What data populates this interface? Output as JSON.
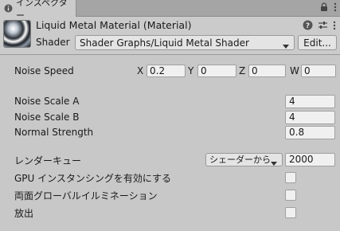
{
  "tab": {
    "label": "インスペクター",
    "icon": "info-icon"
  },
  "tabbar_icons": [
    "lock-icon",
    "menu-icon"
  ],
  "material": {
    "title": "Liquid Metal Material (Material)",
    "shader_label": "Shader",
    "shader_value": "Shader Graphs/Liquid Metal Shader",
    "edit_label": "Edit...",
    "header_icons": [
      "help-icon",
      "settings-sliders-icon",
      "kebab-menu-icon"
    ]
  },
  "properties": {
    "noise_speed": {
      "label": "Noise Speed",
      "x_label": "X",
      "x_value": "0.2",
      "y_label": "Y",
      "y_value": "0",
      "z_label": "Z",
      "z_value": "0",
      "w_label": "W",
      "w_value": "0"
    },
    "noise_scale_a": {
      "label": "Noise Scale A",
      "value": "4"
    },
    "noise_scale_b": {
      "label": "Noise Scale B",
      "value": "4"
    },
    "normal_strength": {
      "label": "Normal Strength",
      "value": "0.8"
    }
  },
  "advanced": {
    "render_queue": {
      "label": "レンダーキュー",
      "dropdown_value": "シェーダーから",
      "value": "2000"
    },
    "gpu_instancing": {
      "label": "GPU インスタンシングを有効にする",
      "checked": false
    },
    "double_sided_gi": {
      "label": "両面グローバルイルミネーション",
      "checked": false
    },
    "emission": {
      "label": "放出",
      "checked": false
    }
  }
}
